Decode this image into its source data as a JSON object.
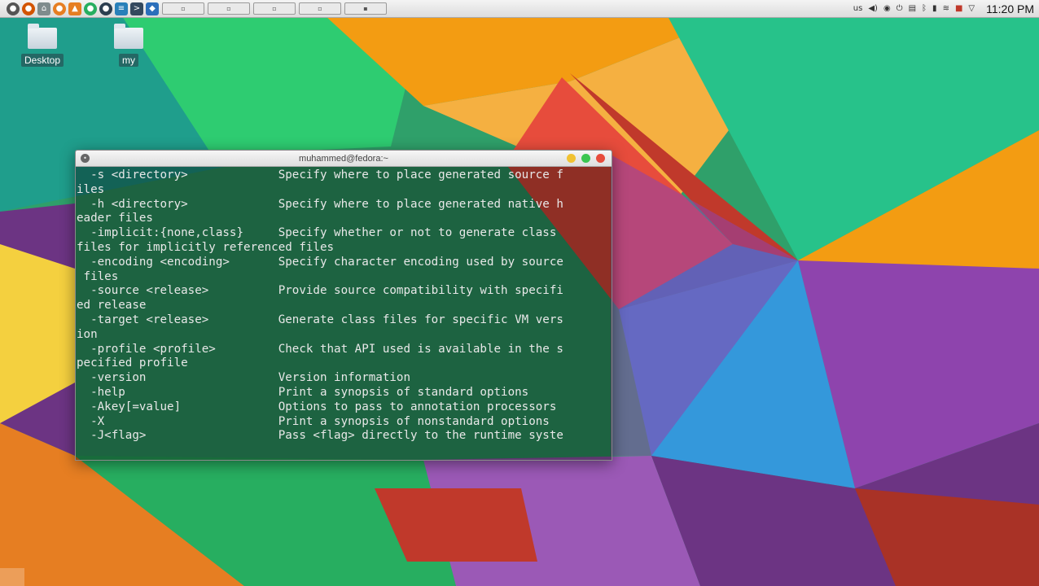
{
  "top_panel": {
    "launchers": [
      {
        "name": "system-icon",
        "color": "#555555",
        "glyph": "●"
      },
      {
        "name": "firefox-icon",
        "color": "#d35400",
        "glyph": "●"
      },
      {
        "name": "home-icon",
        "color": "#7f8c8d",
        "glyph": "⌂"
      },
      {
        "name": "web-icon",
        "color": "#e67e22",
        "glyph": "●"
      },
      {
        "name": "vlc-icon",
        "color": "#e67e22",
        "glyph": "▲"
      },
      {
        "name": "app-icon",
        "color": "#27ae60",
        "glyph": "●"
      },
      {
        "name": "settings-icon",
        "color": "#2c3e50",
        "glyph": "●"
      },
      {
        "name": "text-editor-icon",
        "color": "#2980b9",
        "glyph": "≡"
      },
      {
        "name": "terminal-launcher-icon",
        "color": "#34495e",
        "glyph": ">"
      },
      {
        "name": "shield-icon",
        "color": "#2c6fbb",
        "glyph": "◆"
      }
    ],
    "tray": {
      "keyboard_layout": "us",
      "icons": [
        "volume-icon",
        "media-icon",
        "power-icon",
        "clipboard-icon",
        "bluetooth-icon",
        "battery-icon",
        "network-icon",
        "updates-icon",
        "expand-icon"
      ],
      "clock": "11:20 PM"
    }
  },
  "desktop": {
    "icons": [
      {
        "label": "Desktop"
      },
      {
        "label": "my"
      }
    ]
  },
  "terminal": {
    "title": "muhammed@fedora:~",
    "lines": [
      "  -s <directory>             Specify where to place generated source f",
      "iles",
      "  -h <directory>             Specify where to place generated native h",
      "eader files",
      "  -implicit:{none,class}     Specify whether or not to generate class ",
      "files for implicitly referenced files",
      "  -encoding <encoding>       Specify character encoding used by source",
      " files",
      "  -source <release>          Provide source compatibility with specifi",
      "ed release",
      "  -target <release>          Generate class files for specific VM vers",
      "ion",
      "  -profile <profile>         Check that API used is available in the s",
      "pecified profile",
      "  -version                   Version information",
      "  -help                      Print a synopsis of standard options",
      "  -Akey[=value]              Options to pass to annotation processors",
      "  -X                         Print a synopsis of nonstandard options",
      "  -J<flag>                   Pass <flag> directly to the runtime syste"
    ]
  }
}
